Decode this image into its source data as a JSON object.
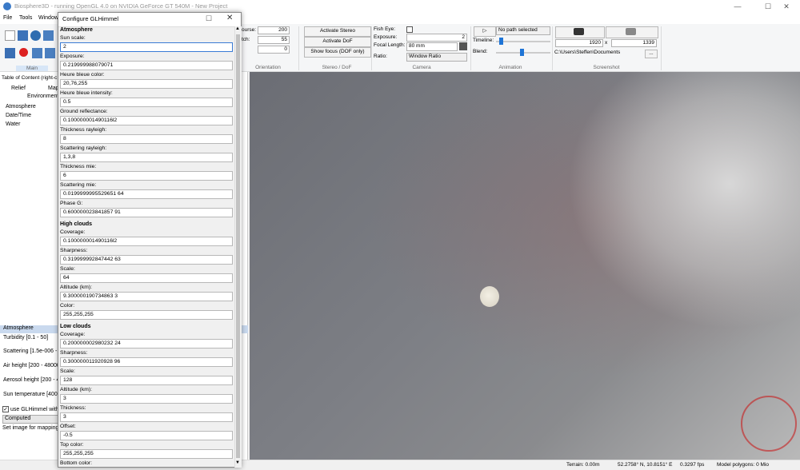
{
  "window": {
    "title": "Biosphere3D - running OpenGL 4.0 on NVIDIA GeForce GT 540M - New Project"
  },
  "menu": {
    "file": "File",
    "tools": "Tools",
    "window": "Window"
  },
  "ribbon": {
    "course_label": "ourse:",
    "course_value": "200",
    "pitch_label": "tch:",
    "pitch_value": "55",
    "roll_value": "0",
    "orientation_label": "Orientation",
    "activate_stereo": "Activate Stereo",
    "activate_dof": "Activate DoF",
    "show_focus": "Show focus (DOF only)",
    "stereo_dof_label": "Stereo / DoF",
    "fish_eye_label": "Fish Eye:",
    "exposure_label": "Exposure:",
    "exposure_value": "2",
    "focal_length_label": "Focal Length:",
    "focal_length_value": "80 mm",
    "ratio_label": "Ratio:",
    "ratio_value": "Window Ratio",
    "camera_label": "Camera",
    "path_select": "No path selected",
    "timeline_label": "Timeline:",
    "blend_label": "Blend:",
    "animation_label": "Animation",
    "width_value": "1920",
    "x_sep": "x",
    "height_value": "1339",
    "path_value": "C:\\Users\\Steffen\\Documents",
    "browse": "...",
    "screenshot_label": "Screenshot"
  },
  "left_panel": {
    "main_tab": "Main",
    "toc_label": "Table of Content (right-c",
    "tabs": [
      "Relief",
      "Map"
    ],
    "environment_label": "Environment",
    "tree": [
      "Atmosphere",
      "Date/Time",
      "Water"
    ],
    "atmosphere_header": "Atmosphere",
    "props": [
      "Turbidity [0.1 - 50]",
      "Scattering [1.5e-006 -",
      "Air height [200 - 48000",
      "Aerosol height [200 - 4",
      "Sun temperature [4000"
    ],
    "use_glhimmel": "use GLHimmel with",
    "computed": "Computed",
    "set_image": "Set image for mapping"
  },
  "dialog": {
    "title": "Configure GLHimmel",
    "atmosphere_section": "Atmosphere",
    "high_clouds_section": "High clouds",
    "low_clouds_section": "Low clouds",
    "atmosphere": [
      {
        "label": "Sun scale:",
        "value": "2"
      },
      {
        "label": "Exposure:",
        "value": "0.219999988079071"
      },
      {
        "label": "Heure bleue color:",
        "value": "20,76,255"
      },
      {
        "label": "Heure bleue intensity:",
        "value": "0.5"
      },
      {
        "label": "Ground reflectance:",
        "value": "0.100000001490116l2"
      },
      {
        "label": "Thickness rayleigh:",
        "value": "8"
      },
      {
        "label": "Scattering rayleigh:",
        "value": "1,3,8"
      },
      {
        "label": "Thickness mie:",
        "value": "6"
      },
      {
        "label": "Scattering mie:",
        "value": "0.0199999995529651 64"
      },
      {
        "label": "Phase G:",
        "value": "0.600000023841857 91"
      }
    ],
    "high_clouds": [
      {
        "label": "Coverage:",
        "value": "0.100000001490116l2"
      },
      {
        "label": "Sharpness:",
        "value": "0.319999992847442 63"
      },
      {
        "label": "Scale:",
        "value": "64"
      },
      {
        "label": "Altitude (km):",
        "value": "9.300000190734863 3"
      },
      {
        "label": "Color:",
        "value": "255,255,255"
      }
    ],
    "low_clouds": [
      {
        "label": "Coverage:",
        "value": "0.200000002980232 24"
      },
      {
        "label": "Sharpness:",
        "value": "0.300000011920928 96"
      },
      {
        "label": "Scale:",
        "value": "128"
      },
      {
        "label": "Altitude (km):",
        "value": "3"
      },
      {
        "label": "Thickness:",
        "value": "3"
      },
      {
        "label": "Offset:",
        "value": "-0.5"
      },
      {
        "label": "Top color:",
        "value": "255,255,255"
      }
    ],
    "bottom_color_label": "Bottom color:"
  },
  "status": {
    "terrain": "Terrain: 0.00m",
    "coords": "52.2758° N, 10.8151° E",
    "fps": "0.3297 fps",
    "polygons": "Model polygons: 0 Mio"
  }
}
